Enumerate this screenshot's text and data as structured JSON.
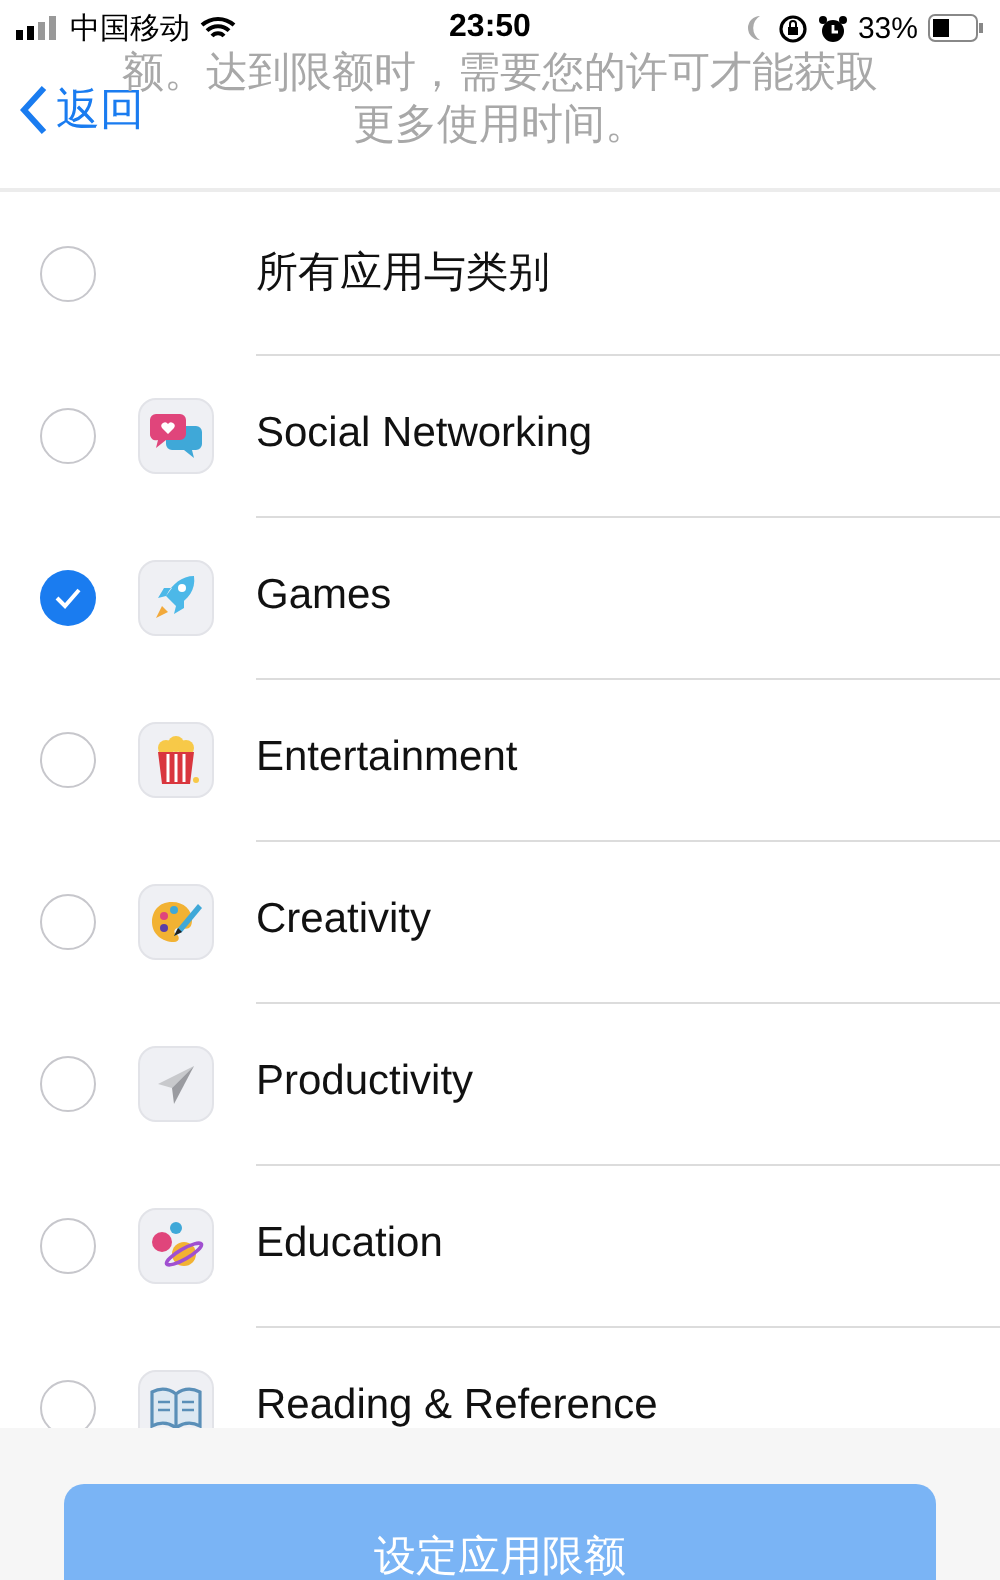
{
  "status_bar": {
    "carrier": "中国移动",
    "time": "23:50",
    "battery": "33%"
  },
  "nav": {
    "back": "返回",
    "description": [
      "额。达到限额时，需要您的许可才能获取",
      "更多使用时间。"
    ]
  },
  "categories": [
    {
      "kind": "all",
      "label": "所有应用与类别",
      "selected": false
    },
    {
      "kind": "category",
      "label": "Social Networking",
      "selected": false
    },
    {
      "kind": "category",
      "label": "Games",
      "selected": true
    },
    {
      "kind": "category",
      "label": "Entertainment",
      "selected": false
    },
    {
      "kind": "category",
      "label": "Creativity",
      "selected": false
    },
    {
      "kind": "category",
      "label": "Productivity",
      "selected": false
    },
    {
      "kind": "category",
      "label": "Education",
      "selected": false
    },
    {
      "kind": "category",
      "label": "Reading & Reference",
      "selected": false
    }
  ],
  "footer": {
    "button": "设定应用限额",
    "disabled": true
  }
}
